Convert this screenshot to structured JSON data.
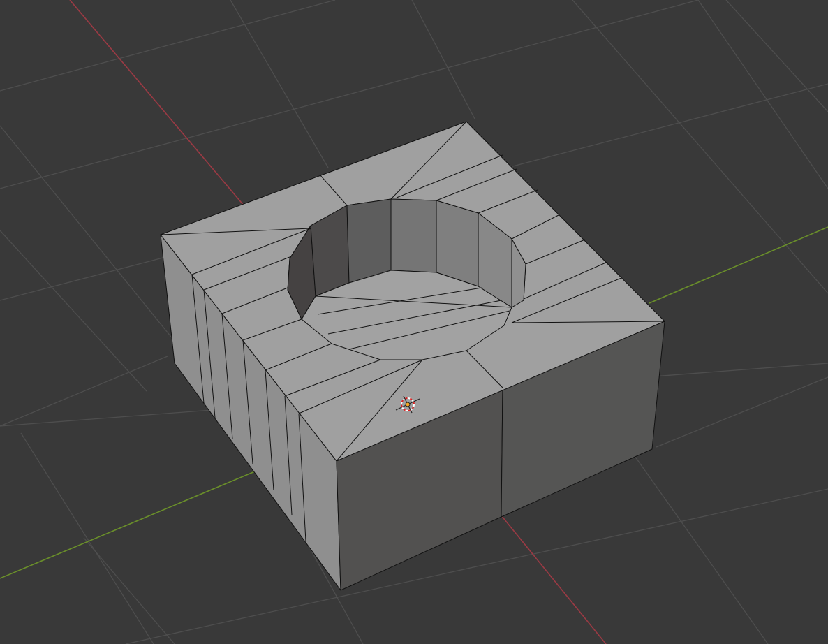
{
  "viewport": {
    "background_color": "#393939",
    "grid_color": "#4d4d4d",
    "x_axis_color": "#9b3a44",
    "y_axis_color": "#6a8f2a",
    "mesh_face_color": "#a0a0a0",
    "mesh_edge_color": "#111111"
  },
  "icons": [
    "3d-cursor-icon",
    "object-origin-icon"
  ]
}
